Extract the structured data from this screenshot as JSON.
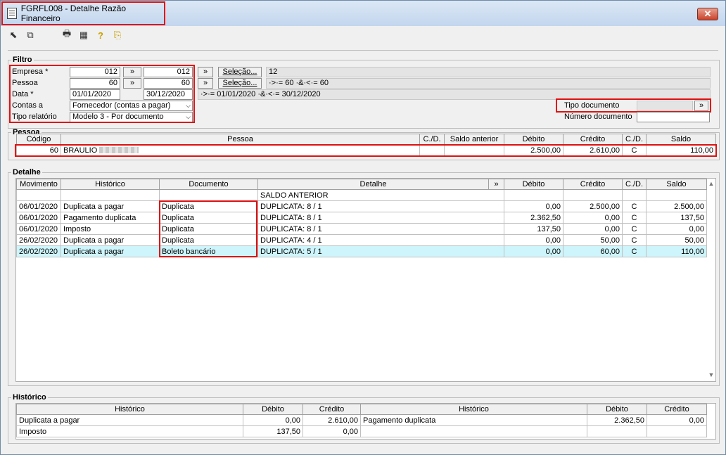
{
  "window": {
    "title": "FGRFL008 - Detalhe Razão Financeiro",
    "close_symbol": "✕"
  },
  "toolbar": {
    "icons": [
      "arrow-nw-icon",
      "windows-icon",
      "print-icon",
      "calculator-icon",
      "help-icon",
      "exit-icon"
    ],
    "glyphs": [
      "⬉",
      "⧉",
      "🖶",
      "▦",
      "?",
      "⎘"
    ]
  },
  "filtro": {
    "legend": "Filtro",
    "empresa": {
      "label": "Empresa *",
      "from": "012",
      "to": "012",
      "arrow": "»",
      "select": "Seleção...",
      "display": "12"
    },
    "pessoa": {
      "label": "Pessoa",
      "from": "60",
      "to": "60",
      "arrow": "»",
      "select": "Seleção...",
      "display": "·>·= 60 ·&·<·= 60"
    },
    "data": {
      "label": "Data *",
      "from": "01/01/2020",
      "to": "30/12/2020",
      "display": "·>·= 01/01/2020 ·&·<·= 30/12/2020"
    },
    "contas": {
      "label": "Contas a",
      "value": "Fornecedor (contas a pagar)"
    },
    "tipo_relatorio": {
      "label": "Tipo relatório",
      "value": "Modelo 3 - Por documento"
    },
    "tipo_documento": {
      "label": "Tipo documento",
      "value": "",
      "arrow": "»"
    },
    "numero_documento": {
      "label": "Número documento",
      "value": ""
    }
  },
  "pessoa_grid": {
    "legend": "Pessoa",
    "columns": [
      "Código",
      "Pessoa",
      "C./D.",
      "Saldo anterior",
      "Débito",
      "Crédito",
      "C./D.",
      "Saldo"
    ],
    "row": {
      "codigo": "60",
      "pessoa": "BRAULIO",
      "cd1": "",
      "saldo_anterior": "",
      "debito": "2.500,00",
      "credito": "2.610,00",
      "cd2": "C",
      "saldo": "110,00"
    }
  },
  "detalhe_grid": {
    "legend": "Detalhe",
    "columns": [
      "Movimento",
      "Histórico",
      "Documento",
      "Detalhe",
      "»",
      "Débito",
      "Crédito",
      "C./D.",
      "Saldo"
    ],
    "saldo_anterior": "SALDO ANTERIOR",
    "rows": [
      {
        "movimento": "06/01/2020",
        "historico": "Duplicata a pagar",
        "documento": "Duplicata",
        "detalhe": "DUPLICATA: 8 / 1",
        "debito": "0,00",
        "credito": "2.500,00",
        "cd": "C",
        "saldo": "2.500,00"
      },
      {
        "movimento": "06/01/2020",
        "historico": "Pagamento duplicata",
        "documento": "Duplicata",
        "detalhe": "DUPLICATA: 8 / 1",
        "debito": "2.362,50",
        "credito": "0,00",
        "cd": "C",
        "saldo": "137,50"
      },
      {
        "movimento": "06/01/2020",
        "historico": "Imposto",
        "documento": "Duplicata",
        "detalhe": "DUPLICATA: 8 / 1",
        "debito": "137,50",
        "credito": "0,00",
        "cd": "C",
        "saldo": "0,00"
      },
      {
        "movimento": "26/02/2020",
        "historico": "Duplicata a pagar",
        "documento": "Duplicata",
        "detalhe": "DUPLICATA: 4 / 1",
        "debito": "0,00",
        "credito": "50,00",
        "cd": "C",
        "saldo": "50,00"
      },
      {
        "movimento": "26/02/2020",
        "historico": "Duplicata a pagar",
        "documento": "Boleto bancário",
        "detalhe": "DUPLICATA: 5 / 1",
        "debito": "0,00",
        "credito": "60,00",
        "cd": "C",
        "saldo": "110,00"
      }
    ]
  },
  "historico_grid": {
    "legend": "Histórico",
    "columns": [
      "Histórico",
      "Débito",
      "Crédito",
      "Histórico",
      "Débito",
      "Crédito"
    ],
    "rows": [
      [
        "Duplicata a pagar",
        "0,00",
        "2.610,00",
        "Pagamento duplicata",
        "2.362,50",
        "0,00"
      ],
      [
        "Imposto",
        "137,50",
        "0,00",
        "",
        "",
        ""
      ]
    ]
  }
}
